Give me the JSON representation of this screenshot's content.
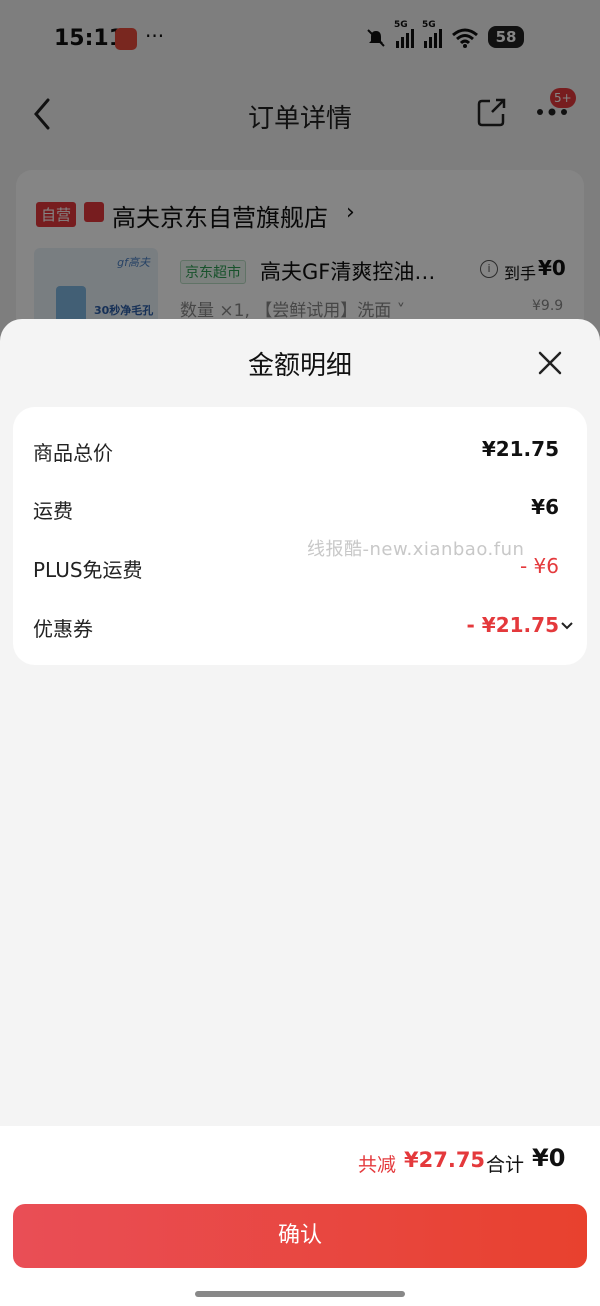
{
  "status_bar": {
    "time": "15:11",
    "more": "···",
    "network1": "5G",
    "network2": "5G",
    "battery": "58"
  },
  "nav": {
    "title": "订单详情",
    "badge": "5+"
  },
  "store": {
    "self_tag": "自营",
    "name": "高夫京东自营旗舰店",
    "arrow": "›",
    "product": {
      "image_brand": "gf高夫",
      "image_caption": "30秒净毛孔",
      "channel_tag": "京东超市",
      "name": "高夫GF清爽控油…",
      "final_label": "到手",
      "final_price": "¥0",
      "spec": "数量 ×1, 【尝鲜试用】洗面 ˅",
      "orig_price": "¥9.9"
    }
  },
  "sheet": {
    "title": "金额明细",
    "rows": [
      {
        "label": "商品总价",
        "value": "¥21.75"
      },
      {
        "label": "运费",
        "value": "¥6"
      },
      {
        "label": "PLUS免运费",
        "value": "- ¥6"
      },
      {
        "label": "优惠券",
        "value": "- ¥21.75"
      }
    ],
    "watermark": "线报酷-new.xianbao.fun"
  },
  "summary": {
    "reduce_label": "共减",
    "reduce_value": "¥27.75",
    "total_label": "合计",
    "total_value": "¥0"
  },
  "confirm": {
    "label": "确认"
  },
  "colors": {
    "accent_red": "#e4393c",
    "button_start": "#e94e56",
    "button_end": "#e8412e",
    "channel_green": "#2e9e55"
  }
}
